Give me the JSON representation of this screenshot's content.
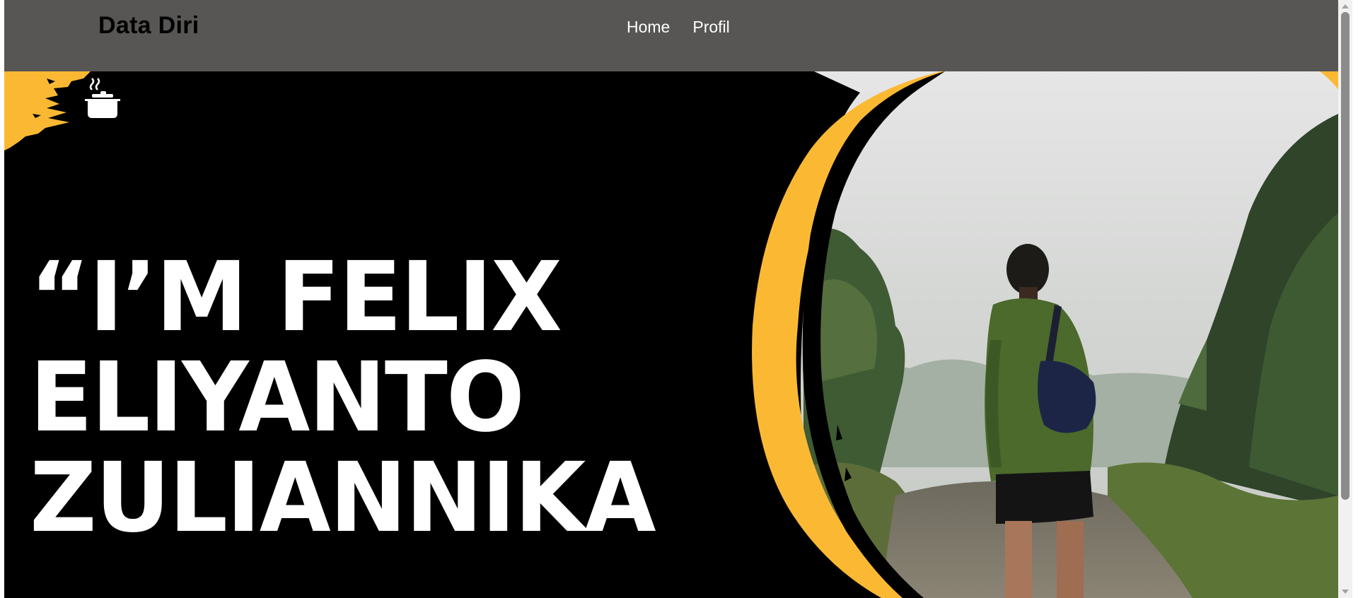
{
  "brand": {
    "title": "Data Diri"
  },
  "nav": {
    "items": [
      {
        "label": "Home"
      },
      {
        "label": "Profil"
      }
    ]
  },
  "hero": {
    "headline_lines": [
      "“I’M FELIX",
      "ELIYANTO",
      "ZULIANNIKA"
    ],
    "logo_icon": "cooking-pot-icon",
    "photo": "person-with-backpack-hiking-photo"
  },
  "colors": {
    "navbar_bg": "#575655",
    "hero_bg": "#000000",
    "accent_yellow": "#fbb933",
    "headline_text": "#ffffff"
  }
}
